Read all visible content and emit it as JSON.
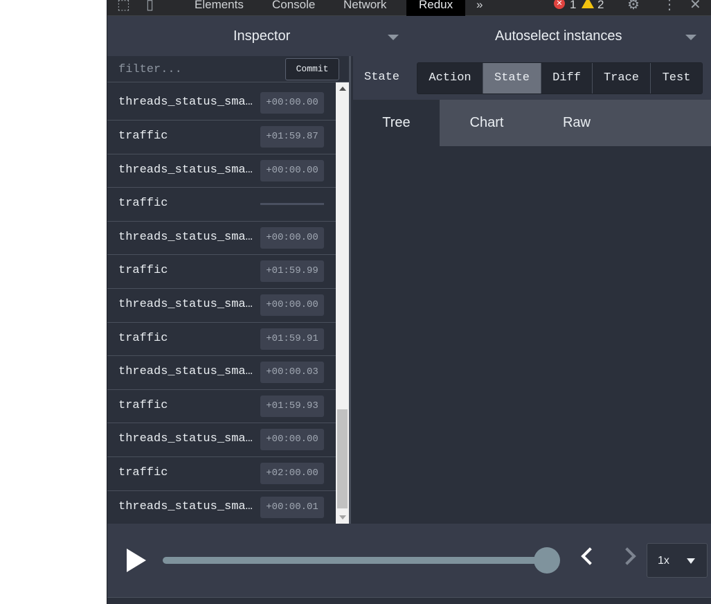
{
  "devtools_tabs": {
    "elements": "Elements",
    "console": "Console",
    "network": "Network",
    "redux": "Redux",
    "more": "»",
    "error_count": "1",
    "warning_count": "2"
  },
  "header": {
    "inspector": "Inspector",
    "autoselect": "Autoselect instances"
  },
  "filter": {
    "placeholder": "filter...",
    "commit_label": "Commit"
  },
  "actions": [
    {
      "name": "threads_status_sma…",
      "time": "+00:00.00"
    },
    {
      "name": "traffic",
      "time": "+01:59.87"
    },
    {
      "name": "threads_status_sma…",
      "time": "+00:00.00"
    },
    {
      "name": "traffic",
      "time": ""
    },
    {
      "name": "threads_status_sma…",
      "time": "+00:00.00"
    },
    {
      "name": "traffic",
      "time": "+01:59.99"
    },
    {
      "name": "threads_status_sma…",
      "time": "+00:00.00"
    },
    {
      "name": "traffic",
      "time": "+01:59.91"
    },
    {
      "name": "threads_status_sma…",
      "time": "+00:00.03"
    },
    {
      "name": "traffic",
      "time": "+01:59.93"
    },
    {
      "name": "threads_status_sma…",
      "time": "+00:00.00"
    },
    {
      "name": "traffic",
      "time": "+02:00.00"
    },
    {
      "name": "threads_status_sma…",
      "time": "+00:00.01"
    }
  ],
  "monitor": {
    "label": "State",
    "buttons": [
      "Action",
      "State",
      "Diff",
      "Trace",
      "Test"
    ],
    "active_button": "State"
  },
  "views": {
    "tabs": [
      "Tree",
      "Chart",
      "Raw"
    ],
    "active": "Tree"
  },
  "slider": {
    "speed": "1x",
    "position_fraction": 1.0
  },
  "colors": {
    "panel_bg": "#2b303b",
    "header_bg": "#373c4a",
    "slider_color": "#7f939d"
  }
}
